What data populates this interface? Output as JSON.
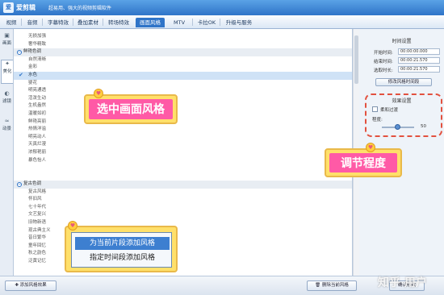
{
  "titlebar": {
    "app_name": "爱剪辑",
    "slogan": "超易用、强大的视频剪辑软件",
    "logo_glyph": "爱"
  },
  "menu": {
    "tabs": [
      "视频",
      "音频",
      "字幕特效",
      "叠加素材",
      "转场特效",
      "画面风格",
      "MTV",
      "卡拉OK",
      "升级与服务"
    ],
    "active_tab": "画面风格"
  },
  "side_tabs": [
    {
      "label": "画面",
      "icon": "image-icon"
    },
    {
      "label": "美化",
      "icon": "wand-icon"
    },
    {
      "label": "滤镜",
      "icon": "filter-icon"
    },
    {
      "label": "动景",
      "icon": "wave-icon"
    }
  ],
  "style_list": [
    {
      "label": "无损加强",
      "type": "item"
    },
    {
      "label": "奢华精致",
      "type": "item"
    },
    {
      "label": "鲜艳色调",
      "type": "header",
      "expand": "−"
    },
    {
      "label": "自然清晰",
      "type": "item"
    },
    {
      "label": "金彩",
      "type": "item"
    },
    {
      "label": "水色",
      "type": "selected"
    },
    {
      "label": "婴花",
      "type": "item"
    },
    {
      "label": "明亮通透",
      "type": "item"
    },
    {
      "label": "活泼生动",
      "type": "item"
    },
    {
      "label": "生机盎然",
      "type": "item"
    },
    {
      "label": "温暖如初",
      "type": "item"
    },
    {
      "label": "鲜艳亮丽",
      "type": "item"
    },
    {
      "label": "热情洋溢",
      "type": "item"
    },
    {
      "label": "明亮动人",
      "type": "item"
    },
    {
      "label": "天真烂漫",
      "type": "item"
    },
    {
      "label": "浓郁艳丽",
      "type": "item"
    },
    {
      "label": "暴色怡人",
      "type": "item"
    },
    {
      "label": "复古色调",
      "type": "header",
      "expand": "−"
    },
    {
      "label": "复古风格",
      "type": "item"
    },
    {
      "label": "怀旧风",
      "type": "item"
    },
    {
      "label": "七十年代",
      "type": "item"
    },
    {
      "label": "文艺复兴",
      "type": "item"
    },
    {
      "label": "旧物新语",
      "type": "item"
    },
    {
      "label": "现古典主义",
      "type": "item"
    },
    {
      "label": "昔日繁华",
      "type": "item"
    },
    {
      "label": "童年回忆",
      "type": "item"
    },
    {
      "label": "秋之韵色",
      "type": "item"
    },
    {
      "label": "泛黄记忆",
      "type": "item"
    }
  ],
  "selected_check": "✔",
  "time_settings": {
    "title": "时间设置",
    "start_label": "开始时间:",
    "start_value": "00:00:00.000",
    "end_label": "结束时间:",
    "end_value": "00:00:21.570",
    "duration_label": "选取时长:",
    "duration_value": "00:00:21.570",
    "modify_button": "修改风格时间段"
  },
  "effect_settings": {
    "title": "效果设置",
    "checkbox_label": "柔和过渡",
    "degree_label": "程度:",
    "degree_value": "50",
    "slider_fraction": 0.5
  },
  "callouts": {
    "select_style": "选中画面风格",
    "adjust_degree": "调节程度"
  },
  "popup_menu": {
    "items": [
      "为当前片段添加风格",
      "指定时间段添加风格"
    ]
  },
  "bottom": {
    "add_button": "添加风格效果",
    "delete_button": "删除当前风格",
    "confirm_button": "确认修改"
  },
  "watermark": "知乎 用户"
}
